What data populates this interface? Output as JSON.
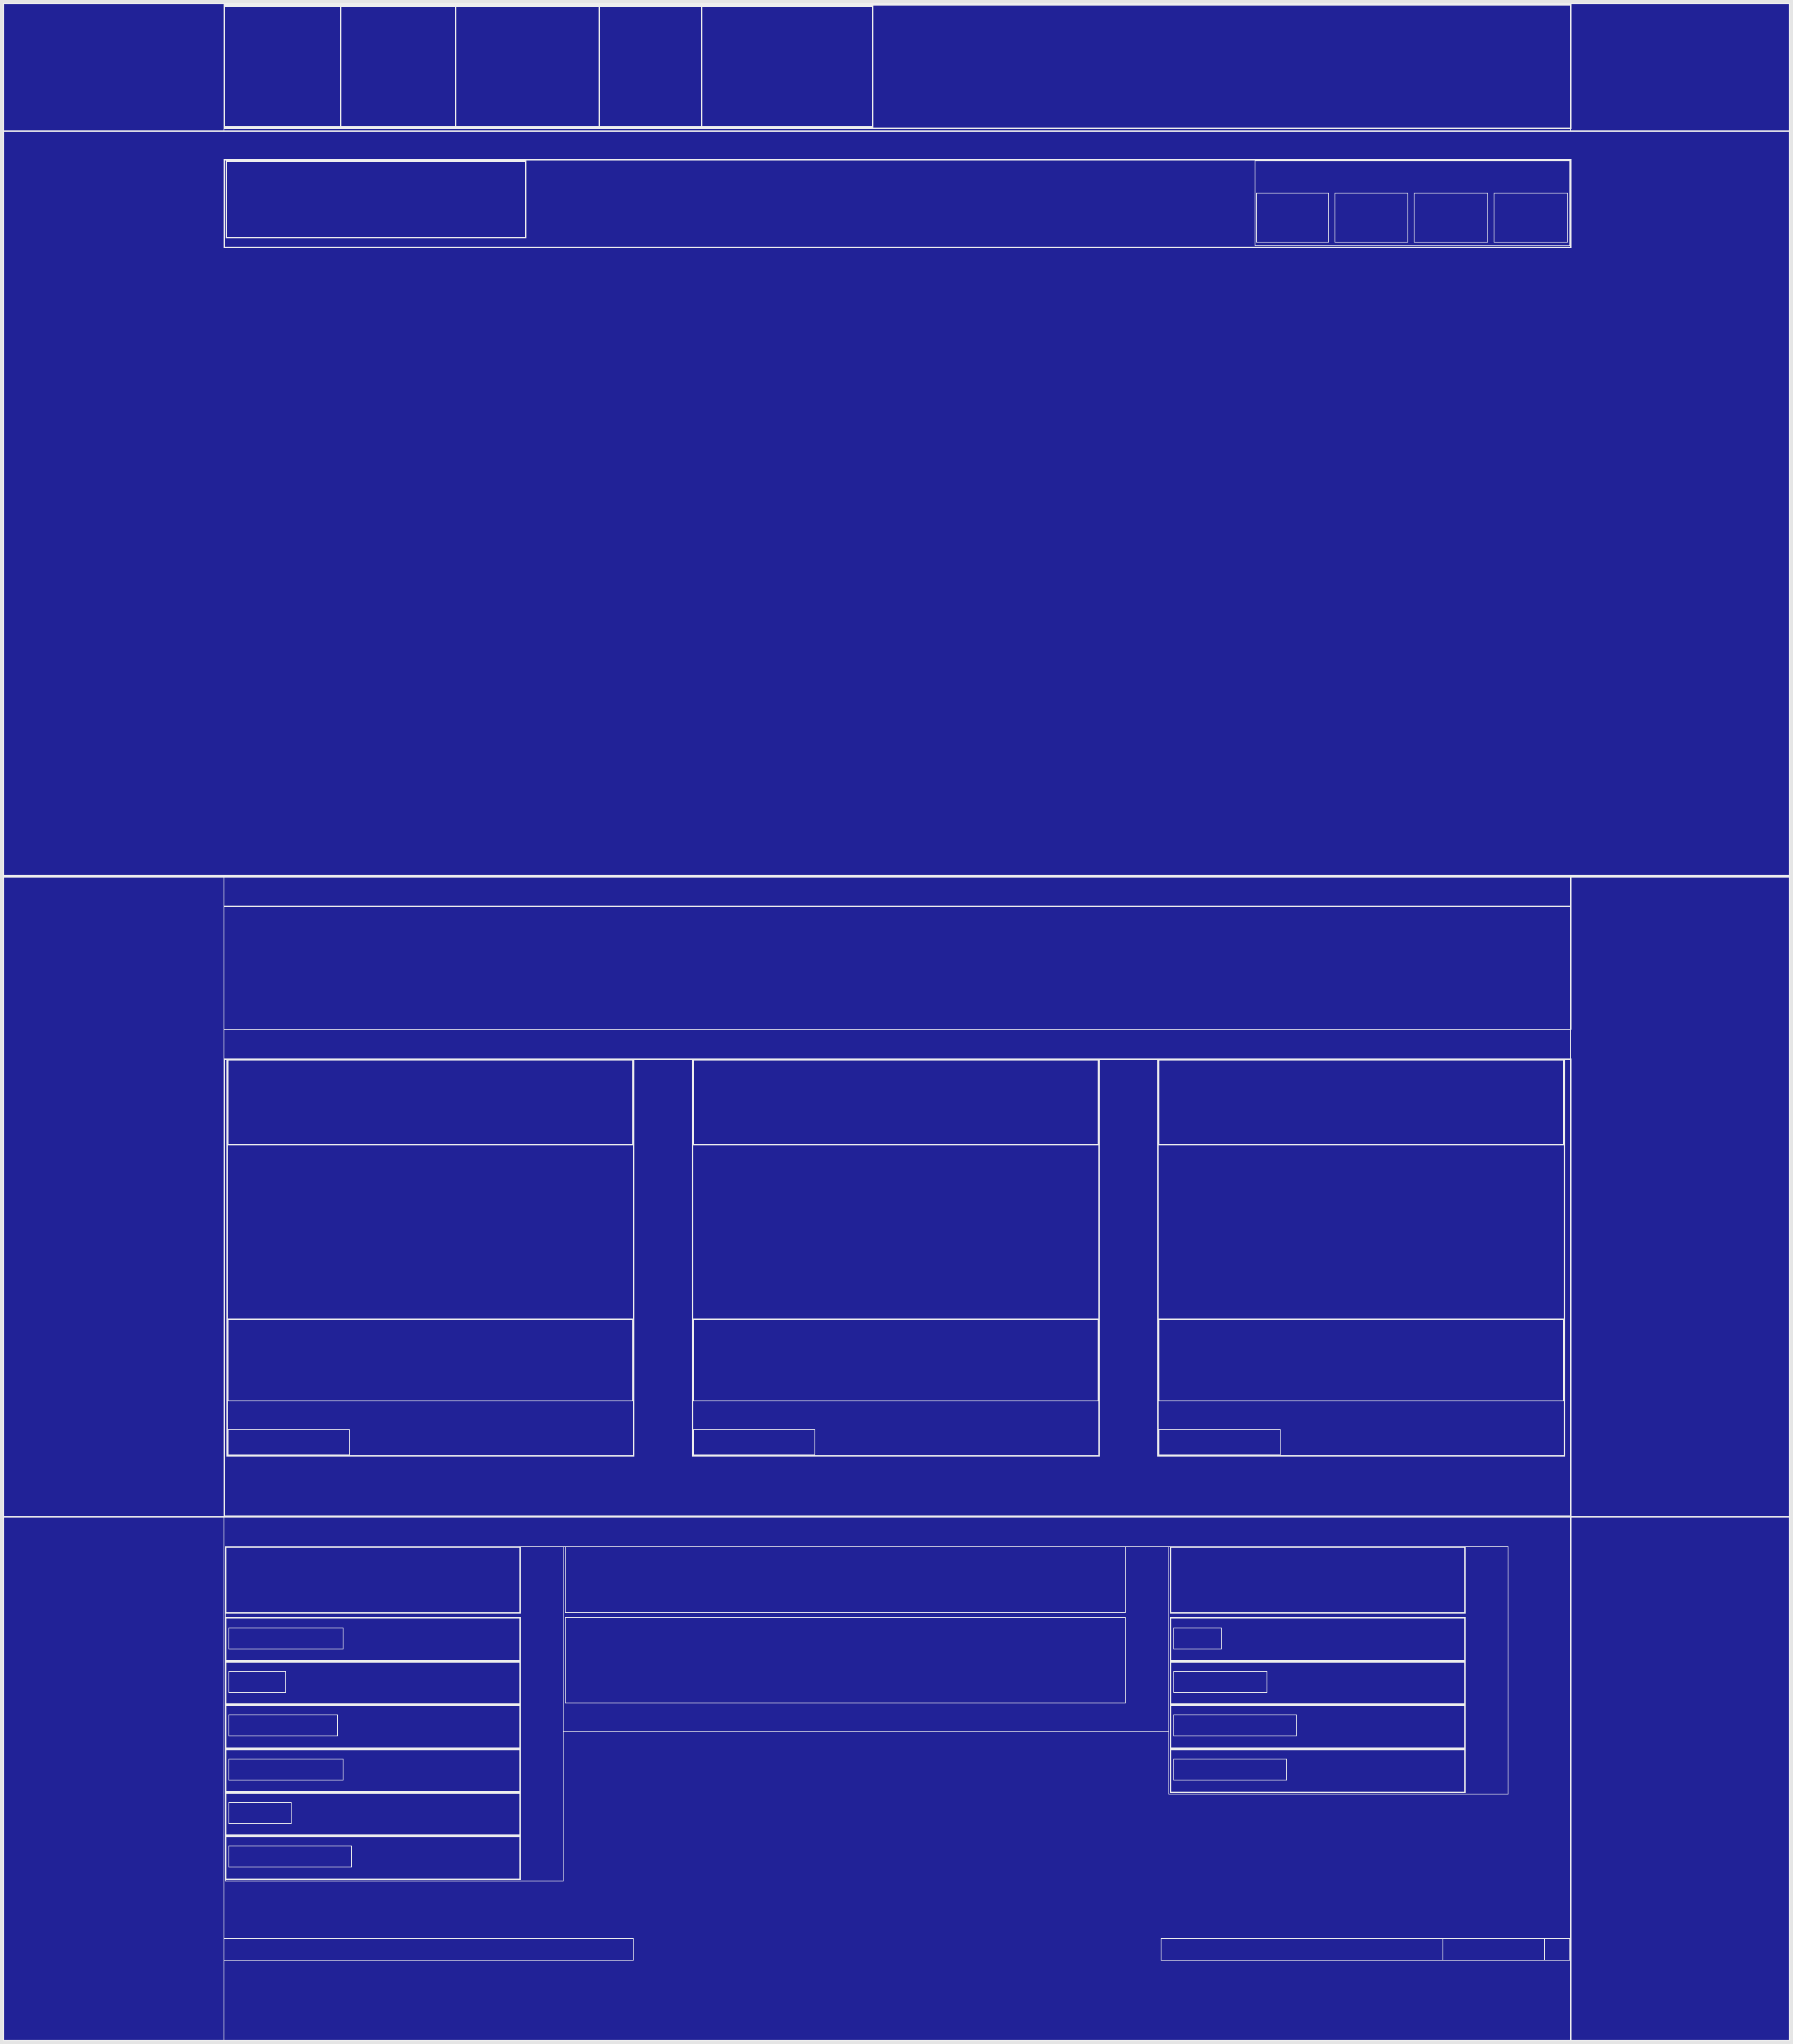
{
  "theme": {
    "background": "#212297",
    "line": "#eeeeee",
    "page_gutter": "#e5e5e5"
  },
  "header": {
    "nav_tabs": [
      "",
      "",
      "",
      "",
      ""
    ],
    "right_panel": ""
  },
  "toolbar": {
    "left_box": "",
    "action_buttons": [
      "",
      "",
      "",
      ""
    ]
  },
  "main": {
    "hero": ""
  },
  "section_two": {
    "banner": "",
    "cards": [
      {
        "title": "",
        "body": "",
        "footer": "",
        "button": ""
      },
      {
        "title": "",
        "body": "",
        "footer": "",
        "button": ""
      },
      {
        "title": "",
        "body": "",
        "footer": "",
        "button": ""
      }
    ]
  },
  "section_three": {
    "left_list": {
      "header": "",
      "items": [
        "",
        "",
        "",
        "",
        "",
        ""
      ]
    },
    "center": {
      "header": "",
      "content": ""
    },
    "right_list": {
      "header": "",
      "items": [
        "",
        "",
        "",
        ""
      ]
    },
    "bottom_left_field": "",
    "bottom_right_field": "",
    "bottom_right_button": ""
  }
}
